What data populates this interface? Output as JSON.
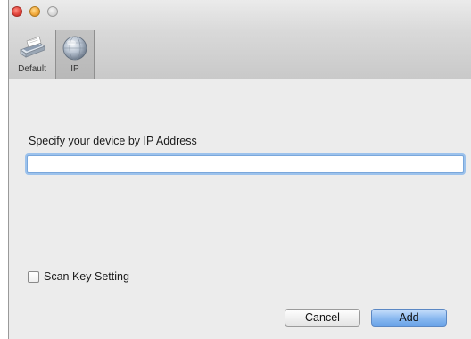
{
  "window": {
    "toolbar": {
      "items": [
        {
          "label": "Default",
          "icon": "scanner-icon",
          "selected": false
        },
        {
          "label": "IP",
          "icon": "network-globe-icon",
          "selected": true
        }
      ]
    }
  },
  "form": {
    "ip_label": "Specify your device by IP Address",
    "ip_value": "",
    "scan_key_label": "Scan Key Setting",
    "scan_key_checked": false
  },
  "buttons": {
    "cancel": "Cancel",
    "add": "Add"
  },
  "colors": {
    "accent": "#6aa3e8",
    "focus_ring": "#9cc2ec",
    "close": "#e0443b",
    "minimize": "#f2a93b"
  }
}
